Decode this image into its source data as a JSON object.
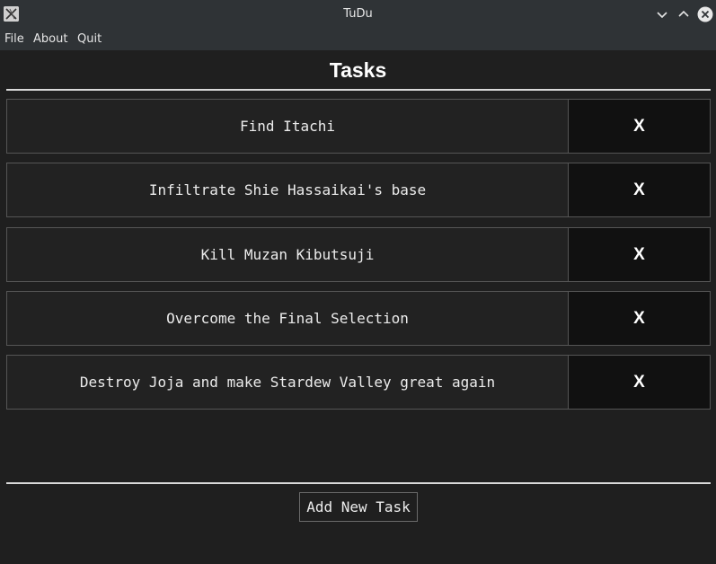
{
  "window": {
    "title": "TuDu"
  },
  "menu": {
    "file": "File",
    "about": "About",
    "quit": "Quit"
  },
  "main": {
    "heading": "Tasks",
    "delete_label": "X",
    "tasks": [
      {
        "text": "Find Itachi",
        "delete_label": "X"
      },
      {
        "text": "Infiltrate Shie Hassaikai's base",
        "delete_label": "X"
      },
      {
        "text": "Kill Muzan Kibutsuji",
        "delete_label": "X"
      },
      {
        "text": "Overcome the Final Selection",
        "delete_label": "X"
      },
      {
        "text": "Destroy Joja and make Stardew Valley great again",
        "delete_label": "X"
      }
    ],
    "add_button": "Add New Task"
  },
  "colors": {
    "background": "#1f1f1f",
    "titlebar": "#2f3336",
    "task_cell": "#222222",
    "delete_cell": "#111111",
    "border": "#555555",
    "text": "#ececec"
  },
  "icons": {
    "app": "app-icon",
    "minimize": "chevron-down-icon",
    "maximize": "chevron-up-icon",
    "close": "close-icon"
  }
}
